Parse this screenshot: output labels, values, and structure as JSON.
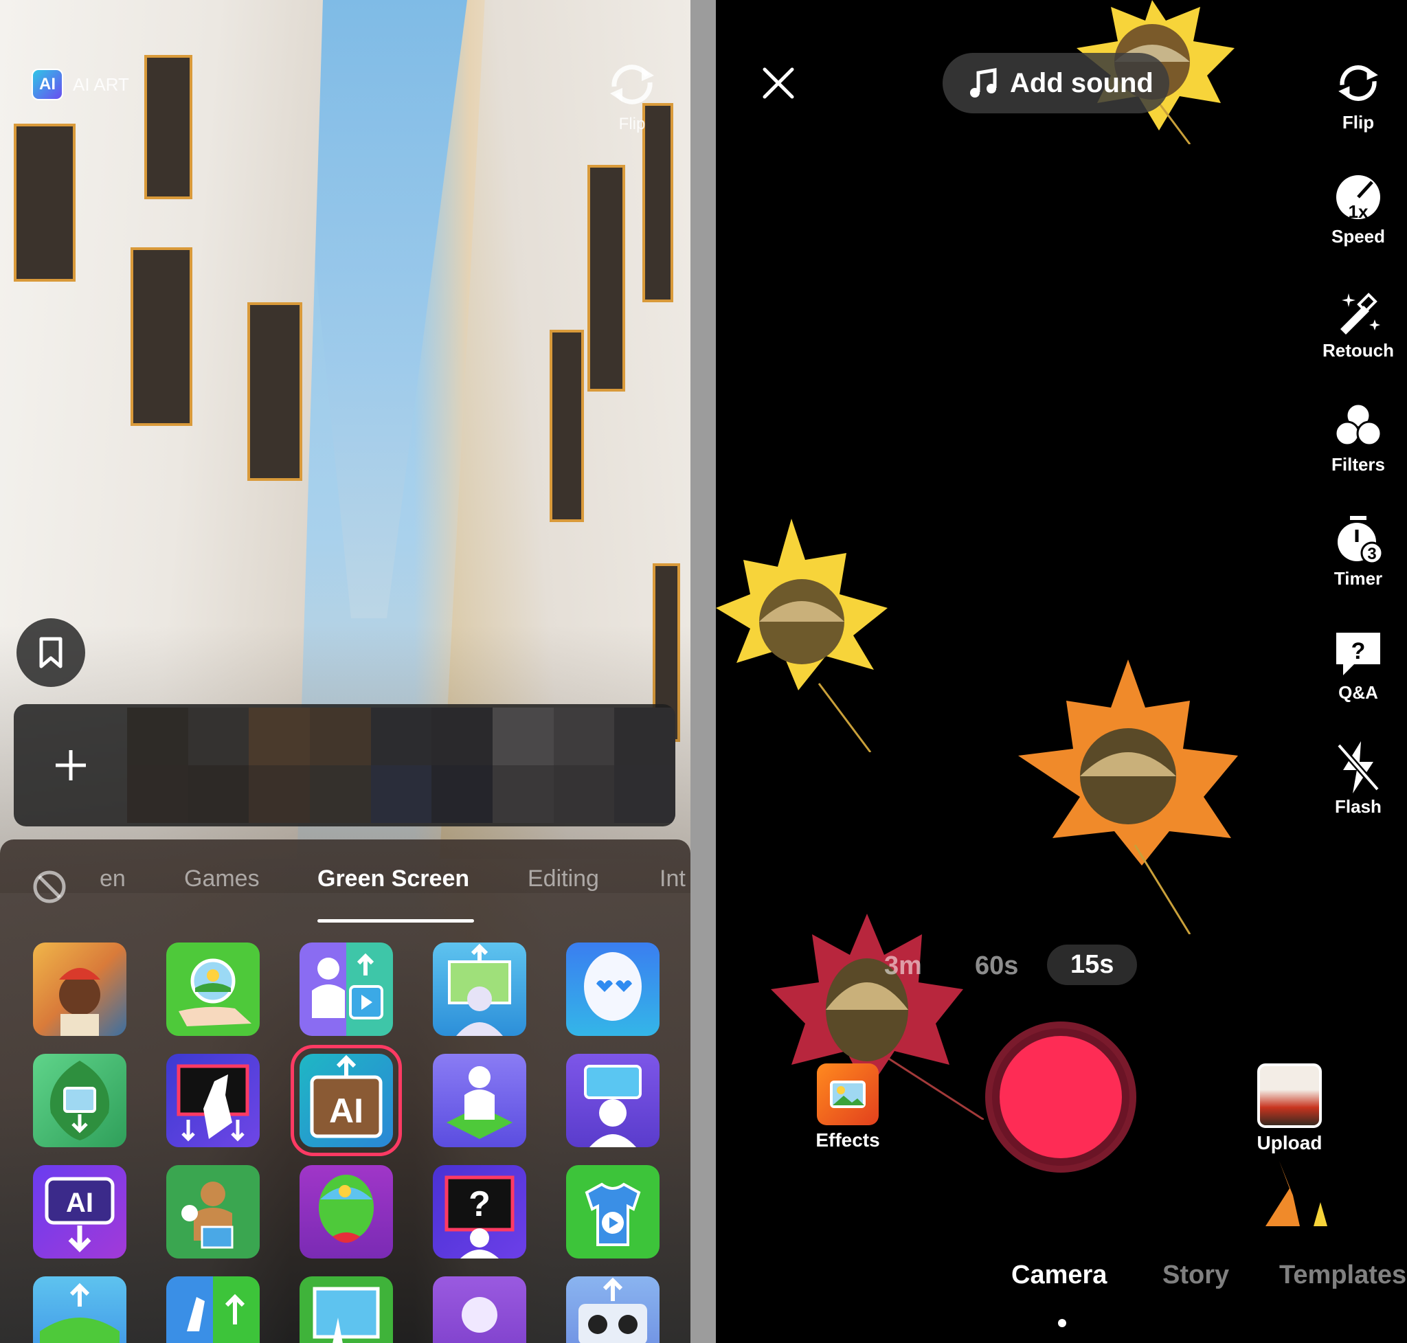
{
  "left_panel": {
    "effect_chip": {
      "badge": "AI",
      "label": "AI ART"
    },
    "flip_label": "Flip",
    "tabs": [
      {
        "label": "en"
      },
      {
        "label": "Games"
      },
      {
        "label": "Green Screen",
        "active": true
      },
      {
        "label": "Editing"
      },
      {
        "label": "Int"
      }
    ],
    "effect_tiles": [
      {
        "icon": "people-collage-icon"
      },
      {
        "icon": "hand-image-icon"
      },
      {
        "icon": "person-video-split-icon"
      },
      {
        "icon": "person-landscape-icon"
      },
      {
        "icon": "heart-eyes-face-icon"
      },
      {
        "icon": "leaf-image-icon"
      },
      {
        "icon": "hand-frame-icon"
      },
      {
        "icon": "ai-art-icon",
        "badge": "AI",
        "selected": true
      },
      {
        "icon": "person-stand-icon"
      },
      {
        "icon": "head-frame-icon"
      },
      {
        "icon": "ai-download-icon",
        "badge": "AI"
      },
      {
        "icon": "holiday-cookie-icon"
      },
      {
        "icon": "face-landscape-icon"
      },
      {
        "icon": "question-frame-icon",
        "badge": "?"
      },
      {
        "icon": "shirt-video-icon"
      },
      {
        "icon": "landscape-upload-icon"
      },
      {
        "icon": "hand-split-icon"
      },
      {
        "icon": "hands-frame-icon"
      },
      {
        "icon": "purple-head-icon"
      },
      {
        "icon": "robot-eyes-icon"
      }
    ]
  },
  "right_panel": {
    "add_sound": "Add sound",
    "tools": [
      {
        "name": "flip",
        "label": "Flip",
        "icon": "flip-icon"
      },
      {
        "name": "speed",
        "label": "Speed",
        "icon": "speed-icon",
        "badge": "1x"
      },
      {
        "name": "retouch",
        "label": "Retouch",
        "icon": "magic-wand-icon"
      },
      {
        "name": "filters",
        "label": "Filters",
        "icon": "filters-icon"
      },
      {
        "name": "timer",
        "label": "Timer",
        "icon": "timer-icon",
        "badge": "3"
      },
      {
        "name": "qa",
        "label": "Q&A",
        "icon": "question-bubble-icon",
        "badge": "?"
      },
      {
        "name": "flash",
        "label": "Flash",
        "icon": "flash-off-icon"
      }
    ],
    "durations": [
      {
        "label": "3m"
      },
      {
        "label": "60s"
      },
      {
        "label": "15s",
        "active": true
      }
    ],
    "effects_label": "Effects",
    "upload_label": "Upload",
    "modes": [
      {
        "label": "Camera",
        "active": true
      },
      {
        "label": "Story"
      },
      {
        "label": "Templates"
      }
    ]
  },
  "colors": {
    "record_red": "#fe2c55",
    "selected_outline": "#ff3a63",
    "leaf_yellow": "#f7d43a",
    "leaf_orange": "#f08a2a",
    "leaf_crimson": "#b8263d"
  }
}
